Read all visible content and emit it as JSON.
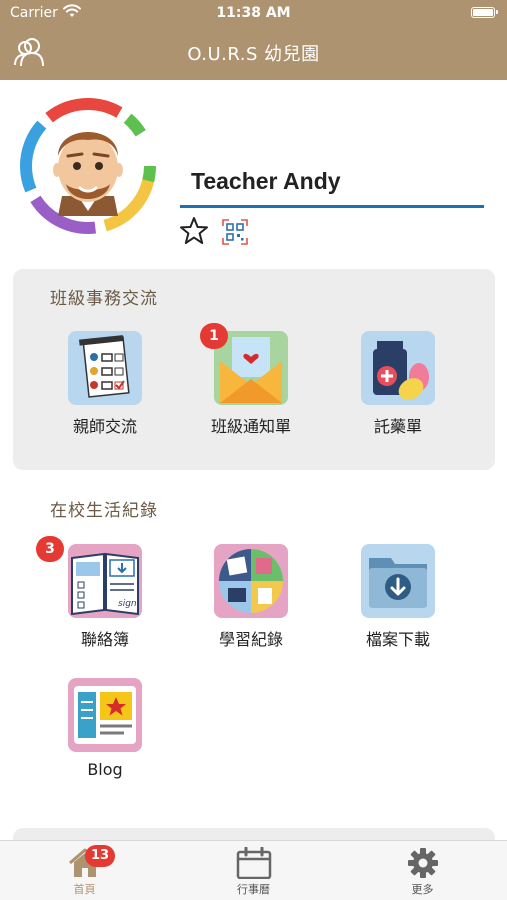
{
  "status_bar": {
    "carrier": "Carrier",
    "time": "11:38 AM",
    "battery_level": 1.0
  },
  "nav": {
    "title": "O.U.R.S 幼兒園"
  },
  "profile": {
    "name": "Teacher Andy"
  },
  "sections": [
    {
      "title": "班級事務交流",
      "items": [
        {
          "label": "親師交流",
          "icon": "checklist-icon",
          "badge": ""
        },
        {
          "label": "班級通知單",
          "icon": "envelope-icon",
          "badge": "1"
        },
        {
          "label": "託藥單",
          "icon": "medicine-icon",
          "badge": ""
        }
      ]
    },
    {
      "title": "在校生活紀錄",
      "items": [
        {
          "label": "聯絡簿",
          "icon": "notebook-icon",
          "badge": "3"
        },
        {
          "label": "學習紀錄",
          "icon": "learning-record-icon",
          "badge": ""
        },
        {
          "label": "檔案下載",
          "icon": "download-folder-icon",
          "badge": ""
        },
        {
          "label": "Blog",
          "icon": "blog-icon",
          "badge": ""
        }
      ]
    }
  ],
  "tabbar": {
    "items": [
      {
        "label": "首頁",
        "icon": "home-icon",
        "badge": "13",
        "active": true
      },
      {
        "label": "行事曆",
        "icon": "calendar-icon",
        "badge": ""
      },
      {
        "label": "更多",
        "icon": "gear-icon",
        "badge": ""
      }
    ]
  },
  "colors": {
    "brand": "#ad9370",
    "badge": "#e43a33",
    "underline": "#1f6fb5",
    "card": "#ededed"
  }
}
